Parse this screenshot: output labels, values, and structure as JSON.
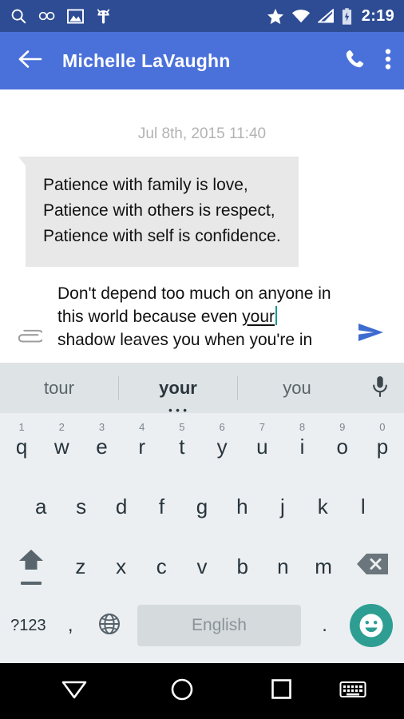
{
  "status_bar": {
    "background": "#2D4C93",
    "time": "2:19",
    "left_icons": [
      "search-icon",
      "infinity-icon",
      "image-icon",
      "android-robot-icon"
    ],
    "right_icons": [
      "star-icon",
      "wifi-icon",
      "cell-signal-icon",
      "battery-charging-icon"
    ]
  },
  "app_bar": {
    "background": "#4A70DA",
    "back_label": "Back",
    "contact_name": "Michelle LaVaughn",
    "call_label": "Call",
    "menu_label": "More options"
  },
  "conversation": {
    "timestamp": "Jul 8th, 2015 11:40",
    "bubble_color": "#E8E8E8",
    "incoming_message": {
      "lines": [
        "Patience with family is love,",
        "Patience with others is respect,",
        "Patience with self is confidence."
      ]
    }
  },
  "compose": {
    "attach_label": "Attach",
    "send_label": "Send",
    "cursor_color": "#159C8E",
    "line1": "Don't depend too much on anyone in",
    "line2_prefix": "this world because even ",
    "line2_composing": "your",
    "line3": "shadow leaves you when you're in",
    "full_text": "Don't depend too much on anyone in this world because even your shadow leaves you when you're in"
  },
  "suggestions": {
    "background": "#DEE3E6",
    "items": [
      {
        "label": "tour",
        "active": false
      },
      {
        "label": "your",
        "active": true
      },
      {
        "label": "you",
        "active": false
      }
    ],
    "mic_label": "Voice input"
  },
  "keyboard": {
    "background": "#EBEFF2",
    "row1": [
      {
        "letter": "q",
        "number": "1"
      },
      {
        "letter": "w",
        "number": "2"
      },
      {
        "letter": "e",
        "number": "3"
      },
      {
        "letter": "r",
        "number": "4"
      },
      {
        "letter": "t",
        "number": "5"
      },
      {
        "letter": "y",
        "number": "6"
      },
      {
        "letter": "u",
        "number": "7"
      },
      {
        "letter": "i",
        "number": "8"
      },
      {
        "letter": "o",
        "number": "9"
      },
      {
        "letter": "p",
        "number": "0"
      }
    ],
    "row2": [
      {
        "letter": "a"
      },
      {
        "letter": "s"
      },
      {
        "letter": "d"
      },
      {
        "letter": "f"
      },
      {
        "letter": "g"
      },
      {
        "letter": "h"
      },
      {
        "letter": "j"
      },
      {
        "letter": "k"
      },
      {
        "letter": "l"
      }
    ],
    "row3": [
      {
        "letter": "z"
      },
      {
        "letter": "x"
      },
      {
        "letter": "c"
      },
      {
        "letter": "v"
      },
      {
        "letter": "b"
      },
      {
        "letter": "n"
      },
      {
        "letter": "m"
      }
    ],
    "shift_label": "Shift",
    "backspace_label": "Backspace",
    "symbols_label": "?123",
    "comma_label": ",",
    "language_label": "Change language",
    "space_label": "English",
    "period_label": ".",
    "emoji_label": "Emoji",
    "emoji_color": "#2E9E93"
  },
  "nav_bar": {
    "background": "#000000",
    "back_label": "Hide keyboard",
    "home_label": "Home",
    "recents_label": "Recent apps",
    "keyboard_switch_label": "Switch keyboard"
  }
}
